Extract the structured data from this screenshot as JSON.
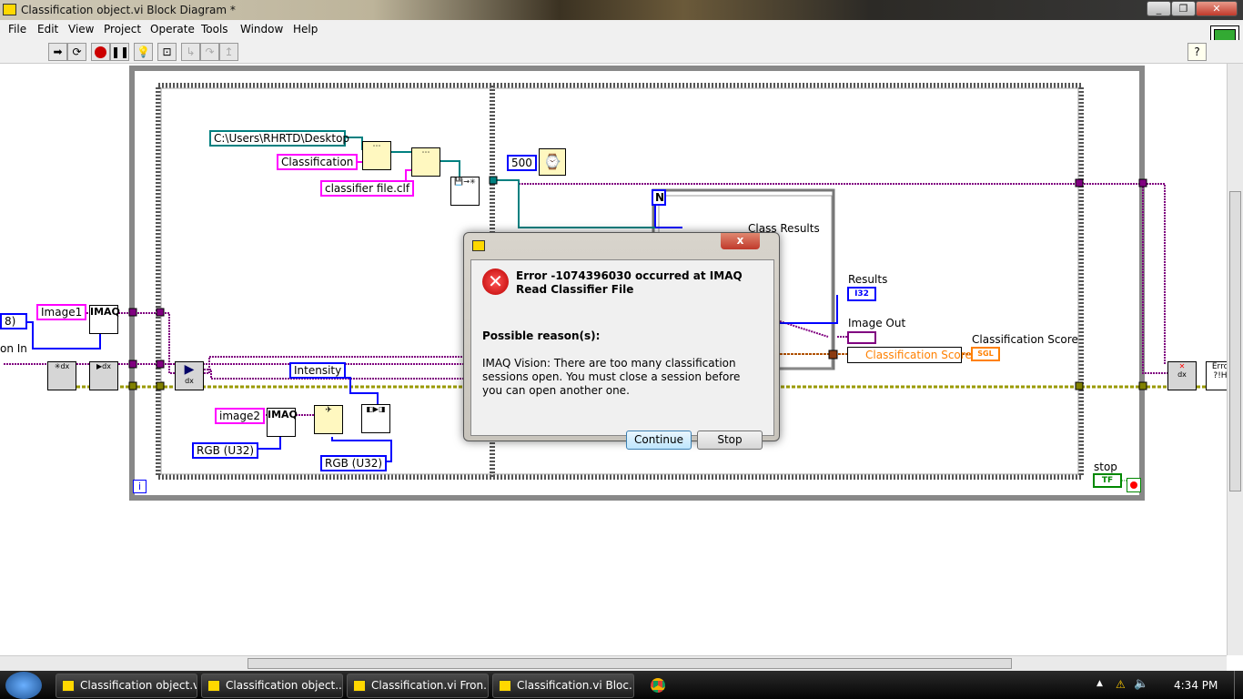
{
  "window": {
    "title": "Classification object.vi Block Diagram *",
    "buttons": [
      "minimize",
      "restore",
      "close"
    ]
  },
  "menu": [
    "File",
    "Edit",
    "View",
    "Project",
    "Operate",
    "Tools",
    "Window",
    "Help"
  ],
  "toolbar": {
    "icons": [
      "run-arrow",
      "run-continuously",
      "abort",
      "pause",
      "highlight-execution",
      "retain-wire-values",
      "step-into",
      "step-over",
      "step-out"
    ],
    "help": "?"
  },
  "diagram": {
    "path_constant": "C:\\Users\\RHRTD\\Desktop",
    "classification_constant": "Classification",
    "file_constant": "classifier file.clf",
    "wait_constant": "500",
    "image1": "Image1",
    "image2": "image2",
    "imaq": "IMAQ",
    "left_enum": "8)",
    "left_label": "on In",
    "intensity": "Intensity",
    "rgb1": "RGB (U32)",
    "rgb2": "RGB (U32)",
    "for_n": "N",
    "class_results": "Class Results",
    "results_label": "Results",
    "results_type": "I32",
    "image_out_label": "Image Out",
    "class_score_node": "Classification Score",
    "class_score_label": "Classification Score",
    "sgl": "SGL",
    "stop_label": "stop",
    "tf": "TF",
    "loop_i": "i",
    "error_node": "Erro ?!H"
  },
  "dialog": {
    "title_icon": "labview-icon",
    "close": "x",
    "heading": "Error -1074396030 occurred at IMAQ Read Classifier File",
    "reason_title": "Possible reason(s):",
    "reason": "IMAQ Vision:  There are too many classification sessions open.  You must close a session before you can open another one.",
    "continue": "Continue",
    "stop": "Stop"
  },
  "taskbar": {
    "items": [
      "Classification object.vi",
      "Classification object....",
      "Classification.vi Fron...",
      "Classification.vi Bloc..."
    ],
    "clock": "4:34 PM"
  },
  "colors": {
    "image_wire": "#800080",
    "error_wire": "#c8c800",
    "enum": "#0000ff",
    "string": "#ff00ff",
    "sgl": "#ff8000"
  }
}
